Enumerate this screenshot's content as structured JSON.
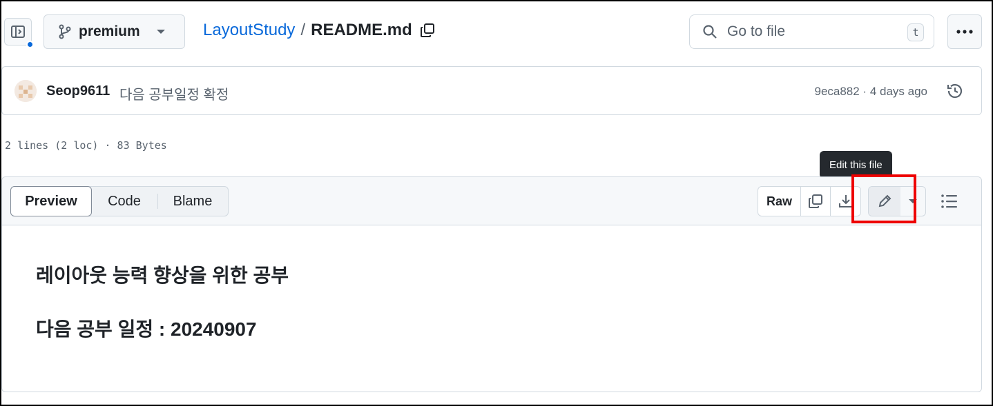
{
  "header": {
    "branch": "premium",
    "repo": "LayoutStudy",
    "separator": "/",
    "file": "README.md",
    "search_placeholder": "Go to file",
    "search_shortcut": "t"
  },
  "commit": {
    "author": "Seop9611",
    "message": "다음 공부일정 확정",
    "meta": "9eca882 · 4 days ago"
  },
  "file_info": "2 lines (2 loc) · 83 Bytes",
  "tooltip": "Edit this file",
  "view_tabs": {
    "preview": "Preview",
    "code": "Code",
    "blame": "Blame"
  },
  "toolbar": {
    "raw": "Raw"
  },
  "content": {
    "line1": "레이아웃 능력 향상을 위한 공부",
    "line2": "다음 공부 일정 : 20240907"
  },
  "colors": {
    "link": "#0969da",
    "highlight": "#ee0000",
    "tooltip_bg": "#25292e"
  }
}
